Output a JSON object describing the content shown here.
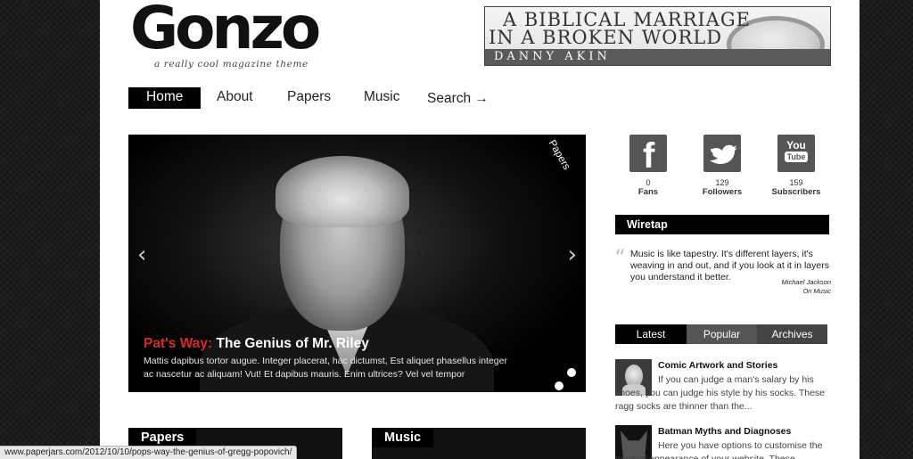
{
  "header": {
    "logo": "Gonzo",
    "tagline": "a really cool magazine theme"
  },
  "ad": {
    "line1": "A BIBLICAL MARRIAGE",
    "line2": "IN A BROKEN WORLD",
    "author": "DANNY AKIN"
  },
  "nav": {
    "items": [
      {
        "label": "Home",
        "active": true
      },
      {
        "label": "About"
      },
      {
        "label": "Papers"
      },
      {
        "label": "Music"
      },
      {
        "label": "Search →"
      }
    ]
  },
  "slider": {
    "ribbon": "Papers",
    "kicker": "Pat's Way:",
    "title": " The Genius of Mr. Riley",
    "text": "Mattis dapibus tortor augue. Integer placerat, hac dictumst, Est aliquet phasellus integer ac nascetur ac aliquam! Vut! Et dapibus mauris. Enim ultrices? Vel vel tempor",
    "prev_icon": "chevron-left-icon",
    "next_icon": "chevron-right-icon"
  },
  "categories": [
    {
      "label": "Papers"
    },
    {
      "label": "Music"
    }
  ],
  "social": [
    {
      "icon": "facebook-icon",
      "glyph": "f",
      "count": "0",
      "label": "Fans"
    },
    {
      "icon": "twitter-icon",
      "glyph": "",
      "count": "129",
      "label": "Followers"
    },
    {
      "icon": "youtube-icon",
      "glyph": "You",
      "glyph2": "Tube",
      "count": "159",
      "label": "Subscribers"
    }
  ],
  "wiretap": {
    "title": "Wiretap",
    "quote": "Music is like tapestry. It's different layers, it's weaving in and out, and if you look at it in layers you understand it better.",
    "author": "Michael Jackson",
    "source": "On Music"
  },
  "tabs": [
    {
      "label": "Latest",
      "active": true
    },
    {
      "label": "Popular"
    },
    {
      "label": "Archives"
    }
  ],
  "posts": [
    {
      "title": "Comic Artwork and Stories",
      "text": "If you can judge a man's salary by his shoes, you can judge his style by his socks. These ragg socks are thinner than the..."
    },
    {
      "title": "Batman Myths and Diagnoses",
      "text": "Here you have options to customise the general appearance of your website. These"
    }
  ],
  "status_bar": {
    "url": "www.paperjars.com/2012/10/10/pops-way-the-genius-of-gregg-popovich/"
  },
  "colors": {
    "accent_red": "#d42a2a",
    "tab_inactive": "#555555",
    "social_icon": "#555555"
  }
}
